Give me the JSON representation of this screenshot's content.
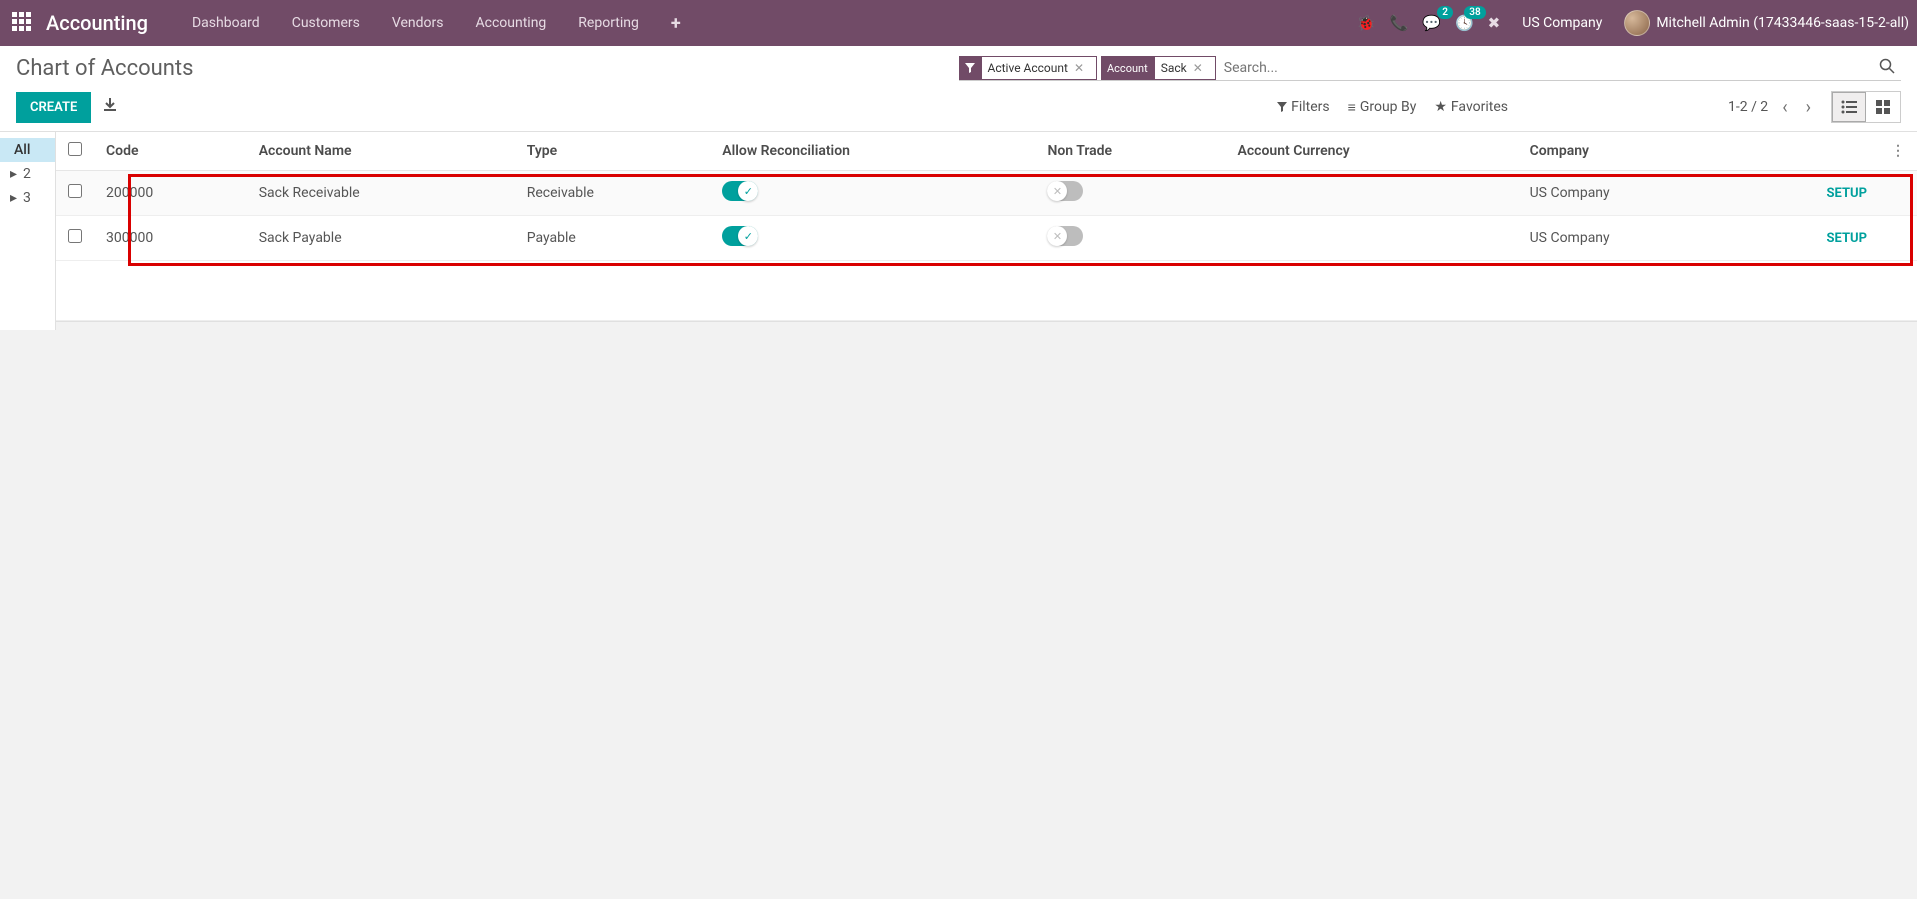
{
  "nav": {
    "brand": "Accounting",
    "links": [
      "Dashboard",
      "Customers",
      "Vendors",
      "Accounting",
      "Reporting"
    ],
    "messaging_badge": "2",
    "activities_badge": "38",
    "company": "US Company",
    "user": "Mitchell Admin (17433446-saas-15-2-all)"
  },
  "page": {
    "title": "Chart of Accounts",
    "create": "CREATE"
  },
  "search": {
    "placeholder": "Search...",
    "facets": [
      {
        "icon": "filter",
        "vals": "Active Account"
      },
      {
        "label": "Account",
        "vals": "Sack"
      }
    ],
    "options": {
      "filters": "Filters",
      "groupby": "Group By",
      "favorites": "Favorites"
    },
    "pager": "1-2 / 2"
  },
  "sidebar": {
    "items": [
      {
        "label": "All",
        "active": true
      },
      {
        "label": "2"
      },
      {
        "label": "3"
      }
    ]
  },
  "table": {
    "headers": [
      "Code",
      "Account Name",
      "Type",
      "Allow Reconciliation",
      "Non Trade",
      "Account Currency",
      "Company"
    ],
    "rows": [
      {
        "code": "200000",
        "name": "Sack Receivable",
        "type": "Receivable",
        "reconcile": true,
        "nontrade": false,
        "currency": "",
        "company": "US Company",
        "setup": "SETUP"
      },
      {
        "code": "300000",
        "name": "Sack Payable",
        "type": "Payable",
        "reconcile": true,
        "nontrade": false,
        "currency": "",
        "company": "US Company",
        "setup": "SETUP"
      }
    ]
  }
}
